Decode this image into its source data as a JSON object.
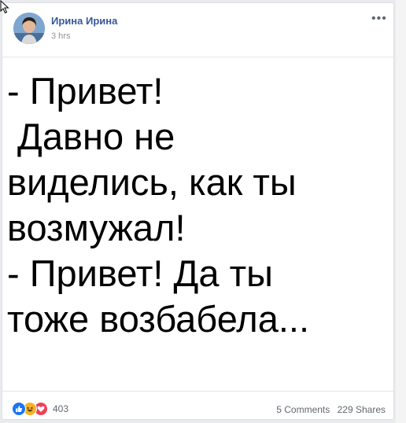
{
  "post": {
    "author": "Ирина Ирина",
    "time": "3 hrs",
    "more_label": "•••"
  },
  "meme": {
    "lines": [
      "- Привет!",
      " Давно не",
      "виделись, как ты",
      "возмужал!",
      "- Привет! Да ты",
      "тоже возбабела..."
    ]
  },
  "footer": {
    "reaction_count": "403",
    "comments": "5 Comments",
    "shares": "229 Shares"
  },
  "colors": {
    "author": "#365899",
    "like": "#1877f2",
    "haha": "#f7b125",
    "love": "#f33e58"
  },
  "icons": [
    "cursor-icon",
    "more-icon",
    "like-reaction-icon",
    "haha-reaction-icon",
    "love-reaction-icon"
  ]
}
